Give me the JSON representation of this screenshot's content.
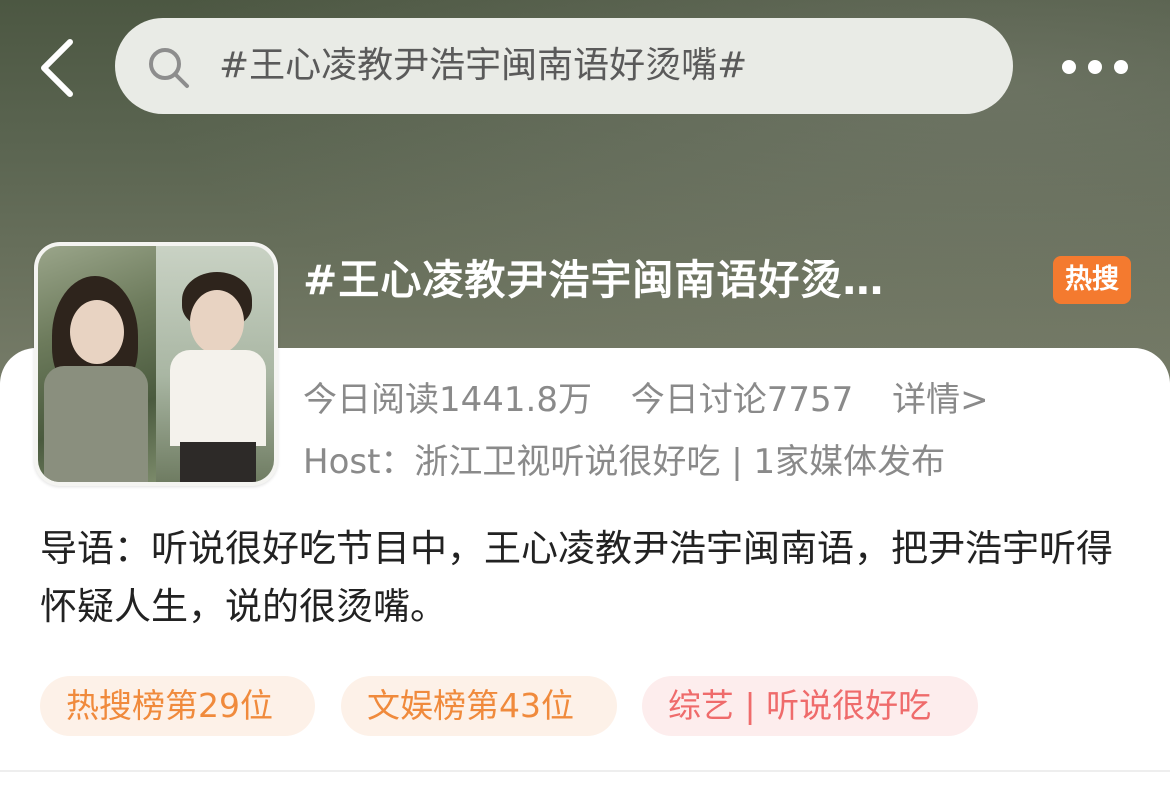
{
  "search": {
    "query": "#王心凌教尹浩宇闽南语好烫嘴#"
  },
  "topic": {
    "title": "#王心凌教尹浩宇闽南语好烫…",
    "badge": "热搜",
    "badge_color": "#f47a2f",
    "reads": "今日阅读1441.8万",
    "discussions": "今日讨论7757",
    "details_link": "详情>",
    "host_line": "Host：浙江卫视听说很好吃 | 1家媒体发布"
  },
  "intro": "导语：听说很好吃节目中，王心凌教尹浩宇闽南语，把尹浩宇听得怀疑人生，说的很烫嘴。",
  "tags": [
    {
      "label": "热搜榜第29位",
      "color": "#f08a3c"
    },
    {
      "label": "文娱榜第43位",
      "color": "#f08a3c"
    },
    {
      "label": "综艺 | 听说很好吃",
      "color": "#ef6b6b"
    }
  ],
  "icons": {
    "back": "chevron-left-icon",
    "search": "search-icon",
    "more": "more-dots-icon"
  }
}
